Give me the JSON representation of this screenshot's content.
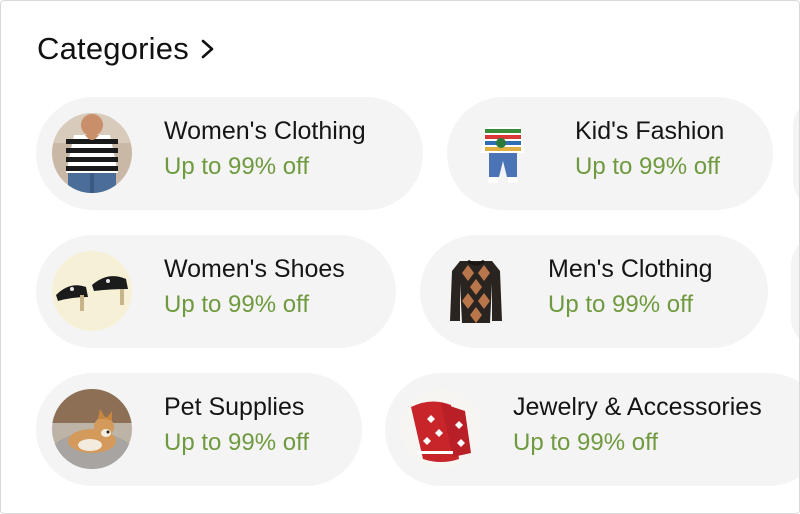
{
  "section": {
    "title": "Categories",
    "chevron_icon": "chevron-right-icon"
  },
  "colors": {
    "pill_background": "#f4f4f4",
    "deal_text": "#6f9a3f",
    "title_text": "#111111"
  },
  "categories": [
    {
      "name": "Women's Clothing",
      "deal": "Up to 99% off",
      "icon": "womens-clothing-thumbnail"
    },
    {
      "name": "Kid's Fashion",
      "deal": "Up to 99% off",
      "icon": "kids-fashion-thumbnail"
    },
    {
      "name": "Women's Shoes",
      "deal": "Up to 99% off",
      "icon": "womens-shoes-thumbnail"
    },
    {
      "name": "Men's Clothing",
      "deal": "Up to 99% off",
      "icon": "mens-clothing-thumbnail"
    },
    {
      "name": "Pet Supplies",
      "deal": "Up to 99% off",
      "icon": "pet-supplies-thumbnail"
    },
    {
      "name": "Jewelry & Accessories",
      "deal": "Up to 99% off",
      "icon": "jewelry-accessories-thumbnail"
    }
  ]
}
